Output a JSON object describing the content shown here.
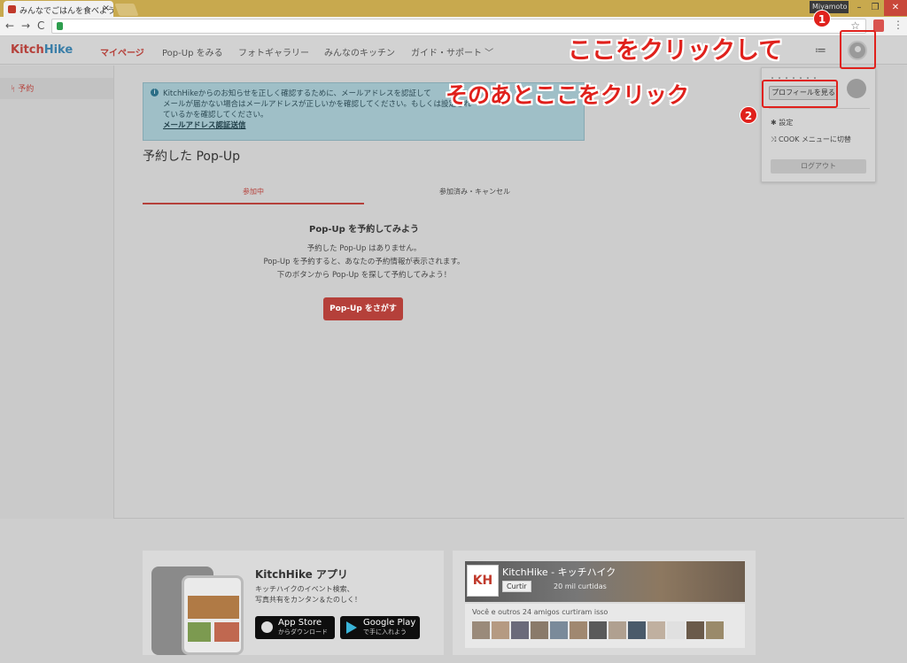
{
  "browser": {
    "tab_title": "みんなでごはんを食べよう - ",
    "tab_close": "×",
    "user": "Miyamoto",
    "win_min": "–",
    "win_max": "❐",
    "win_close": "✕",
    "nav_back": "←",
    "nav_forward": "→",
    "nav_reload": "C",
    "star": "☆",
    "kebab": "⋮"
  },
  "header": {
    "logo_a": "Kitch",
    "logo_b": "Hike",
    "menu": [
      "マイページ",
      "Pop-Up をみる",
      "フォトギャラリー",
      "みんなのキッチン",
      "ガイド・サポート ﹀"
    ]
  },
  "sidebar": {
    "item_icon": "ᛋ",
    "item": "予約"
  },
  "alert": {
    "icon": "i",
    "text": "KitchHikeからのお知らせを正しく確認するために、メールアドレスを認証して",
    "text2": "メールが届かない場合はメールアドレスが正しいかを確認してください。もしくは",
    "text2_tail": "設定され",
    "text3": "ているかを確認してください。",
    "link": "メールアドレス認証送信"
  },
  "main": {
    "title": "予約した Pop-Up",
    "tab_active": "参加中",
    "tab_other": "参加済み・キャンセル",
    "empty_title": "Pop-Up を予約してみよう",
    "empty_lines": [
      "予約した Pop-Up はありません。",
      "Pop-Up を予約すると、あなたの予約情報が表示されます。",
      "下のボタンから Pop-Up を探して予約してみよう！"
    ],
    "cta": "Pop-Up をさがす"
  },
  "dropdown": {
    "profile_button": "プロフィールを見る",
    "settings": "設定",
    "cook_switch": "COOK メニューに切替",
    "logout": "ログアウト",
    "settings_icon": "✱",
    "switch_icon": "⤨"
  },
  "footer": {
    "app_title": "KitchHike アプリ",
    "app_desc_1": "キッチハイクのイベント検索、",
    "app_desc_2": "写真共有をカンタン＆たのしく！",
    "appstore_main": "App Store",
    "appstore_sub": "からダウンロード",
    "gplay_main": "Google Play",
    "gplay_sub": "で手に入れよう",
    "fb_name": "KitchHike - キッチハイク",
    "fb_like": "Curtir",
    "fb_likes": "20 mil curtidas",
    "fb_friends": "Você e outros 24 amigos curtiram isso"
  },
  "annotations": {
    "step1_num": "1",
    "step2_num": "2",
    "step1_text": "ここをクリックして",
    "step2_text": "そのあとここをクリック"
  },
  "colors": {
    "accent": "#b5403a",
    "annotation": "#e0211c"
  }
}
